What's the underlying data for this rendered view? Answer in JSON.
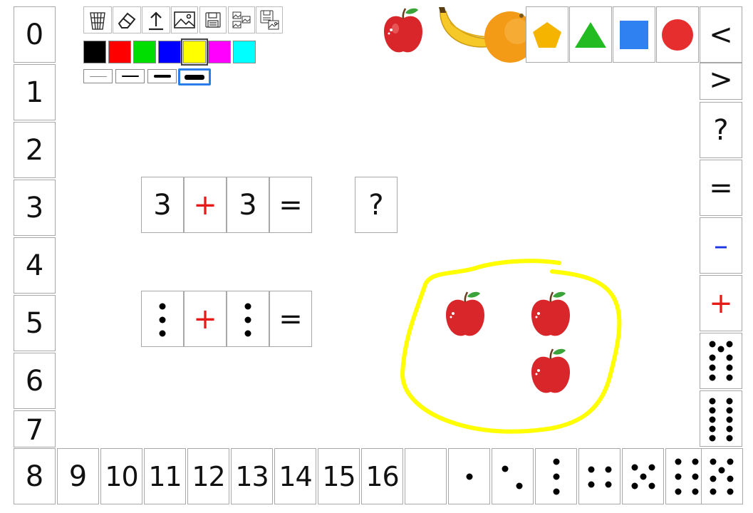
{
  "left_numbers": [
    "0",
    "1",
    "2",
    "3",
    "4",
    "5",
    "6",
    "7"
  ],
  "bottom_numbers": [
    "8",
    "9",
    "10",
    "11",
    "12",
    "13",
    "14",
    "15",
    "16"
  ],
  "toolbar": {
    "icons": [
      "trash-icon",
      "eraser-icon",
      "upload-icon",
      "image-icon",
      "save-icon",
      "gallery-icon",
      "save-gallery-icon"
    ],
    "colors": [
      "#000000",
      "#ff0000",
      "#00dd00",
      "#0000ff",
      "#ffff00",
      "#ff00ff",
      "#00ffff"
    ],
    "selected_color": "#ffff00",
    "stroke_widths": [
      "thin",
      "medium",
      "thick",
      "extra-thick"
    ],
    "selected_stroke": "extra-thick"
  },
  "top_palette": {
    "fruits": [
      "apple-icon",
      "banana-icon",
      "orange-icon"
    ],
    "shapes": [
      "pentagon-icon",
      "triangle-icon",
      "square-icon",
      "circle-icon"
    ],
    "shape_colors": {
      "pentagon": "#f4b400",
      "triangle": "#22bb22",
      "square": "#2f80f0",
      "circle": "#e62e2e"
    }
  },
  "right_column": {
    "labels": [
      "<",
      ">",
      "?",
      "=",
      "–",
      "+"
    ],
    "dice": [
      9,
      10
    ]
  },
  "equation_row1": [
    "3",
    "+",
    "3",
    "=",
    "?"
  ],
  "equation_row2": {
    "left_dots": 3,
    "op": "+",
    "right_dots": 3,
    "eq": "="
  },
  "bottom_dice": [
    0,
    1,
    2,
    3,
    4,
    5,
    6,
    7
  ],
  "canvas": {
    "apple_count": 3,
    "loop_color": "#ffff00"
  }
}
